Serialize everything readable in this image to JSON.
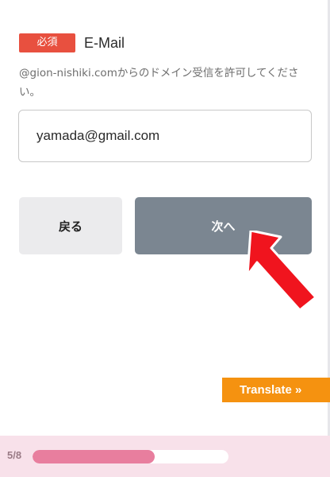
{
  "field": {
    "required_badge": "必須",
    "label": "E-Mail",
    "help_text": "@gion-nishiki.comからのドメイン受信を許可してください。",
    "value": "yamada@gmail.com"
  },
  "buttons": {
    "back_label": "戻る",
    "next_label": "次へ"
  },
  "translate": {
    "label": "Translate »"
  },
  "progress": {
    "label": "5/8",
    "fraction": 0.625
  },
  "colors": {
    "required": "#e8503f",
    "next_button": "#7b8691",
    "translate": "#f59210",
    "progress_fill": "#e87e9e",
    "annotation_arrow": "#f0141e"
  }
}
